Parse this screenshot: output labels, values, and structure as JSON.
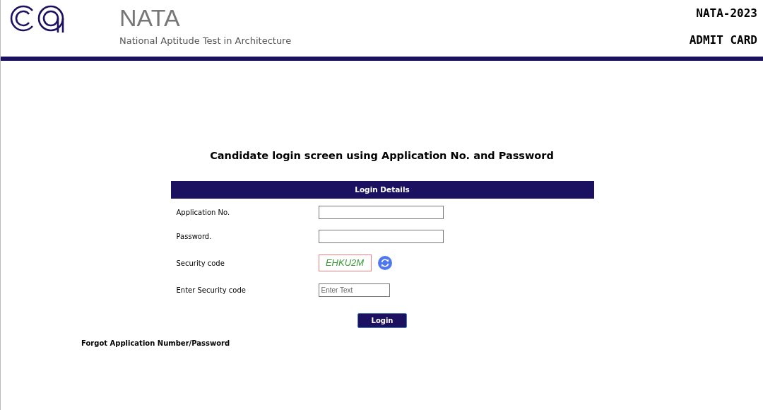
{
  "header": {
    "title": "NATA",
    "subtitle": "National Aptitude Test in Architecture",
    "exam": "NATA-2023",
    "document": "ADMIT CARD"
  },
  "heading": "Candidate login screen using Application No. and Password",
  "form": {
    "title": "Login Details",
    "rows": [
      {
        "kind": "input",
        "label": "Application No."
      },
      {
        "kind": "input",
        "label": "Password."
      },
      {
        "kind": "captcha",
        "label": "Security code",
        "code": "EHKU2M"
      },
      {
        "kind": "short-input",
        "label": "Enter Security code",
        "placeholder": "Enter Text"
      }
    ],
    "submit": "Login"
  },
  "forgot_link": "Forgot Application Number/Password"
}
